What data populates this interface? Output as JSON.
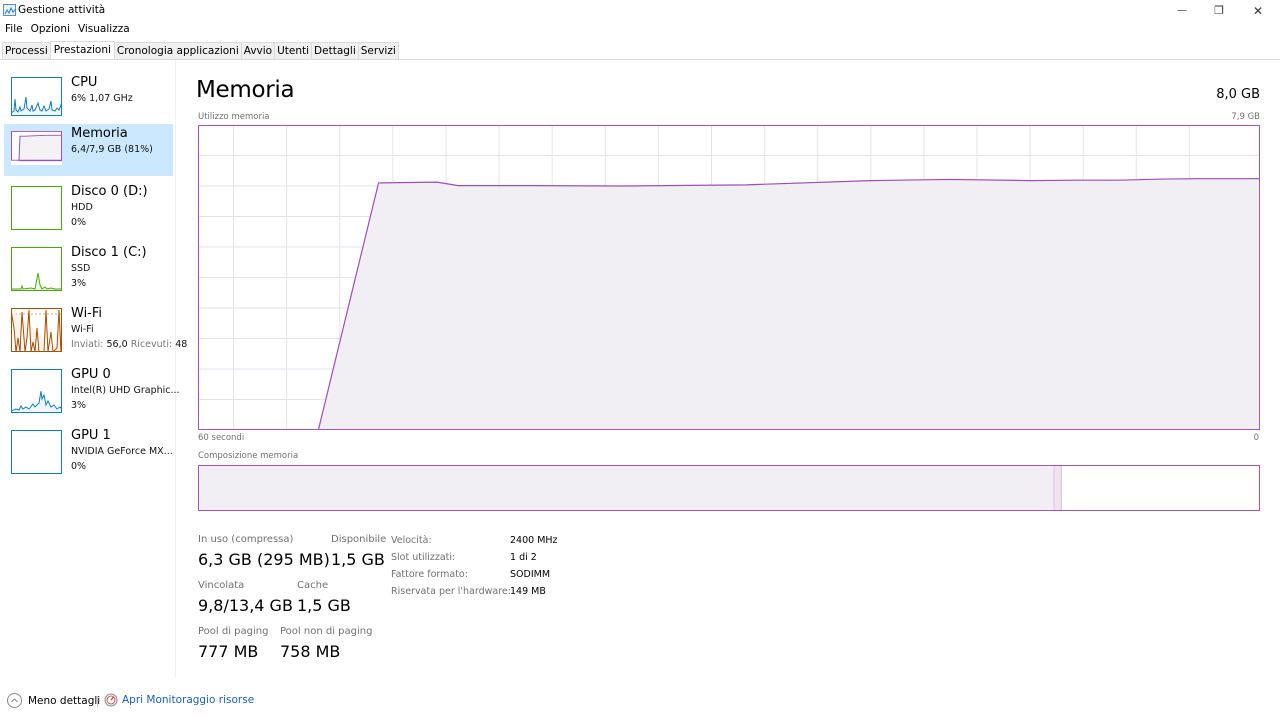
{
  "window": {
    "title": "Gestione attività",
    "controls": {
      "minimize": "—",
      "maximize": "❐",
      "close": "✕"
    }
  },
  "menu": [
    "File",
    "Opzioni",
    "Visualizza"
  ],
  "tabs": [
    {
      "label": "Processi",
      "active": false
    },
    {
      "label": "Prestazioni",
      "active": true
    },
    {
      "label": "Cronologia applicazioni",
      "active": false
    },
    {
      "label": "Avvio",
      "active": false
    },
    {
      "label": "Utenti",
      "active": false
    },
    {
      "label": "Dettagli",
      "active": false
    },
    {
      "label": "Servizi",
      "active": false
    }
  ],
  "sidebar": {
    "items": [
      {
        "title": "CPU",
        "line1": "6% 1,07 GHz",
        "line2": "",
        "color": "#117dbb",
        "fill": "#f1f6fa",
        "selected": false
      },
      {
        "title": "Memoria",
        "line1": "6,4/7,9 GB (81%)",
        "line2": "",
        "color": "#8b12ae",
        "fill": "#f4f2f4",
        "selected": true
      },
      {
        "title": "Disco 0 (D:)",
        "line1": "HDD",
        "line2": "0%",
        "color": "#4da60c",
        "fill": "#eff7ea",
        "selected": false
      },
      {
        "title": "Disco 1 (C:)",
        "line1": "SSD",
        "line2": "3%",
        "color": "#4da60c",
        "fill": "#eff7ea",
        "selected": false
      },
      {
        "title": "Wi-Fi",
        "line1": "Wi-Fi",
        "line2_label1": "Inviati:",
        "line2_value1": "56,0",
        "line2_label2": "Ricevuti:",
        "line2_value2": "48",
        "color": "#a74f01",
        "fill": "#fcf3eb",
        "selected": false
      },
      {
        "title": "GPU 0",
        "line1": "Intel(R) UHD Graphic...",
        "line2": "3%",
        "color": "#117dbb",
        "fill": "#f1f6fa",
        "selected": false
      },
      {
        "title": "GPU 1",
        "line1": "NVIDIA GeForce MX...",
        "line2": "0%",
        "color": "#117dbb",
        "fill": "#f1f6fa",
        "selected": false
      }
    ]
  },
  "main": {
    "title": "Memoria",
    "total_capacity": "8,0 GB",
    "usage_chart": {
      "label": "Utilizzo memoria",
      "max_label": "7,9 GB",
      "x_left_label": "60 secondi",
      "x_right_label": "0"
    },
    "composition": {
      "label": "Composizione memoria",
      "in_use_fraction": 0.806,
      "modified_fraction": 0.007
    },
    "stats": {
      "in_use_label": "In uso (compressa)",
      "in_use_value": "6,3 GB (295 MB)",
      "available_label": "Disponibile",
      "available_value": "1,5 GB",
      "committed_label": "Vincolata",
      "committed_value": "9,8/13,4 GB",
      "cached_label": "Cache",
      "cached_value": "1,5 GB",
      "paged_label": "Pool di paging",
      "paged_value": "777 MB",
      "nonpaged_label": "Pool non di paging",
      "nonpaged_value": "758 MB"
    },
    "details": [
      {
        "label": "Velocità:",
        "value": "2400 MHz"
      },
      {
        "label": "Slot utilizzati:",
        "value": "1 di 2"
      },
      {
        "label": "Fattore formato:",
        "value": "SODIMM"
      },
      {
        "label": "Riservata per l'hardware:",
        "value": "149 MB"
      }
    ]
  },
  "footer": {
    "less_details": "Meno dettagli",
    "open_monitor": "Apri Monitoraggio risorse"
  },
  "theme": {
    "memory_line": "#9b4fb8",
    "memory_border": "#a355c2",
    "memory_fill": "#f2eff4",
    "grid": "#e6e2e8",
    "link": "#1a5fb4",
    "selected": "#cce8ff"
  },
  "chart_data": {
    "type": "area",
    "title": "Utilizzo memoria",
    "xlabel": "60 secondi",
    "ylabel": "",
    "x_range_seconds": [
      60,
      0
    ],
    "ylim_gb": [
      0,
      7.9
    ],
    "grid": true,
    "x_seconds_ago": [
      60,
      53.2,
      49.8,
      46.5,
      45.3,
      41.0,
      36.2,
      29.0,
      22.0,
      17.5,
      13.0,
      10.5,
      8.0,
      5.5,
      3.5,
      0
    ],
    "y_gb": [
      0,
      0,
      6.4,
      6.42,
      6.33,
      6.33,
      6.32,
      6.35,
      6.46,
      6.49,
      6.46,
      6.47,
      6.47,
      6.5,
      6.51,
      6.51
    ],
    "note": "Series estimated from visible trace; before ~53s ago no data recorded"
  }
}
